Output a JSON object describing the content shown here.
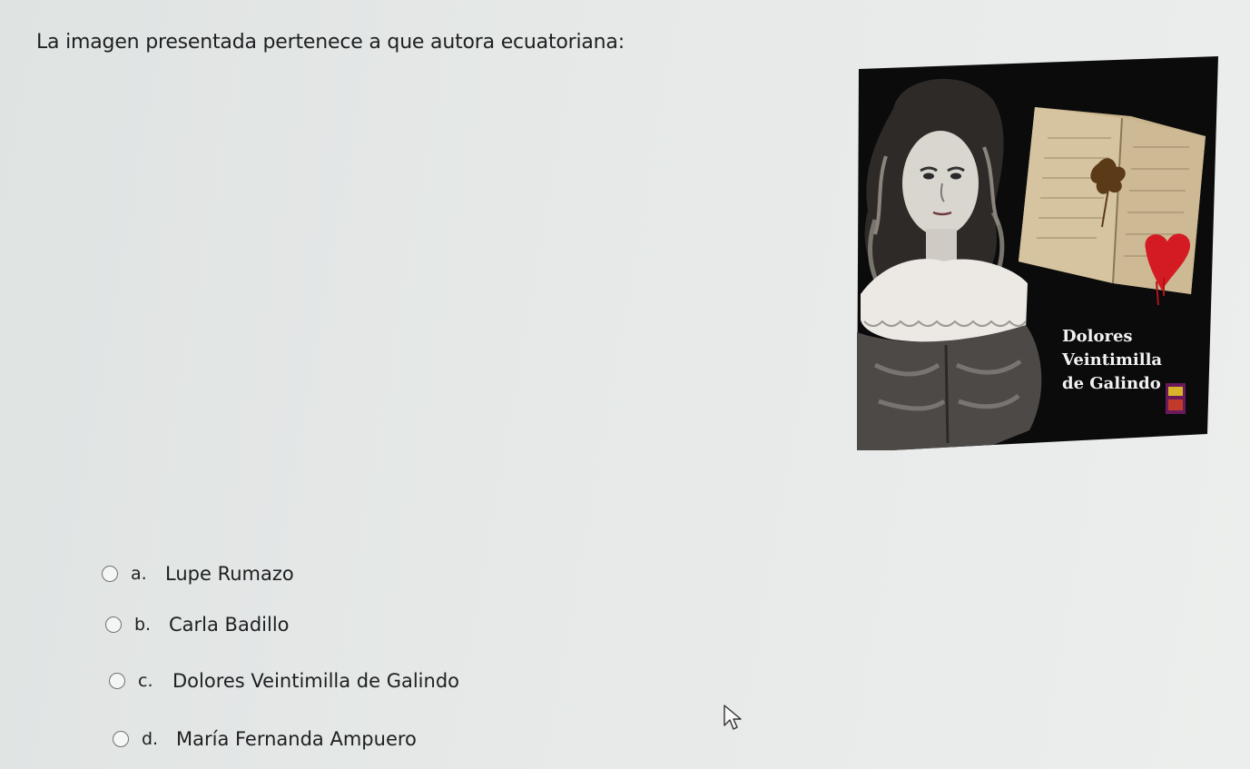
{
  "question": {
    "text": "La imagen presentada pertenece a que autora ecuatoriana:"
  },
  "image": {
    "caption_line1": "Dolores",
    "caption_line2": "Veintimilla",
    "caption_line3": "de Galindo",
    "colors": {
      "background": "#0b0b0b",
      "page": "#c9b48e",
      "heart": "#d41a22"
    }
  },
  "options": [
    {
      "letter": "a.",
      "text": "Lupe Rumazo"
    },
    {
      "letter": "b.",
      "text": "Carla Badillo"
    },
    {
      "letter": "c.",
      "text": "Dolores Veintimilla de Galindo"
    },
    {
      "letter": "d.",
      "text": "María Fernanda Ampuero"
    }
  ]
}
